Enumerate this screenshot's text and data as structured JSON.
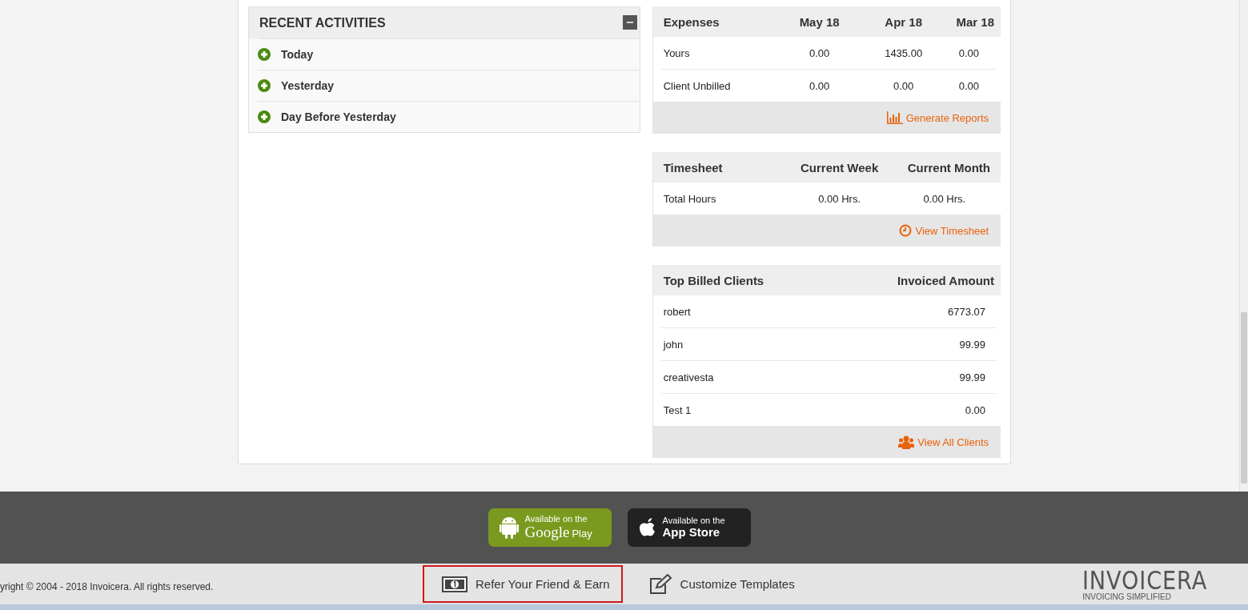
{
  "activities": {
    "title": "RECENT ACTIVITIES",
    "collapsed": false,
    "items": [
      {
        "label": "Today",
        "expanded": false
      },
      {
        "label": "Yesterday",
        "expanded": false
      },
      {
        "label": "Day Before Yesterday",
        "expanded": false
      }
    ]
  },
  "expenses": {
    "columns": [
      "Expenses",
      "May 18",
      "Apr 18",
      "Mar 18"
    ],
    "rows": [
      [
        "Yours",
        "0.00",
        "1435.00",
        "0.00"
      ],
      [
        "Client Unbilled",
        "0.00",
        "0.00",
        "0.00"
      ]
    ],
    "link": {
      "label": "Generate Reports",
      "kind": "chart"
    }
  },
  "timesheet": {
    "columns": [
      "Timesheet",
      "Current Week",
      "Current Month"
    ],
    "rows": [
      [
        "Total Hours",
        "0.00 Hrs.",
        "0.00 Hrs."
      ]
    ],
    "link": {
      "label": "View Timesheet",
      "kind": "clock"
    }
  },
  "clients": {
    "columns": [
      "Top Billed Clients",
      "Invoiced Amount"
    ],
    "rows": [
      [
        "robert",
        "6773.07"
      ],
      [
        "john",
        "99.99"
      ],
      [
        "creativesta",
        "99.99"
      ],
      [
        "Test 1",
        "0.00"
      ]
    ],
    "link": {
      "label": "View All Clients",
      "kind": "people"
    }
  },
  "app_badges": [
    {
      "kind": "android",
      "caption": "Available on the",
      "brand": "Google",
      "store": "Play"
    },
    {
      "kind": "apple",
      "caption": "Available on the",
      "brand": "App Store"
    }
  ],
  "copyright": "yright © 2004 - 2018 Invoicera. All rights reserved.",
  "footer_links": [
    {
      "label": "Refer Your Friend & Earn",
      "kind": "money",
      "highlighted": true
    },
    {
      "label": "Customize Templates",
      "kind": "edit",
      "highlighted": false
    }
  ],
  "logo": {
    "name": "INVOICERA",
    "tagline": "INVOICING SIMPLIFIED"
  }
}
